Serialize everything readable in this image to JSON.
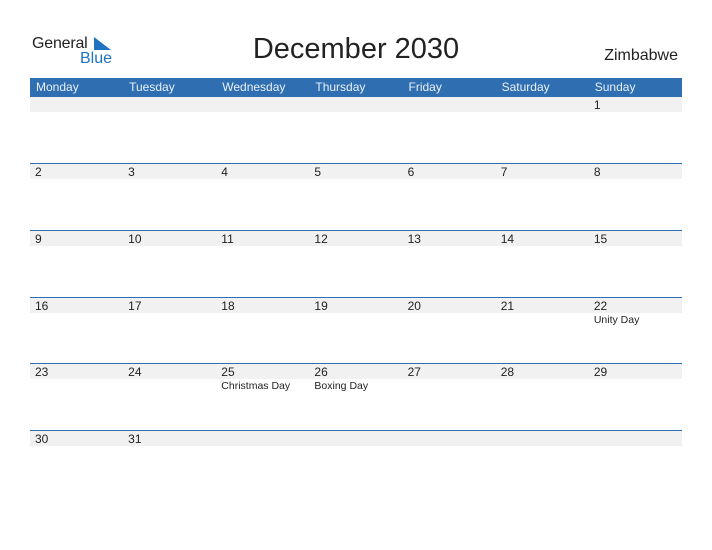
{
  "logo": {
    "line1": "General",
    "line2": "Blue",
    "accent_color": "#1f73c1"
  },
  "title": "December 2030",
  "country": "Zimbabwe",
  "header_color": "#2f6fb1",
  "weekdays": [
    "Monday",
    "Tuesday",
    "Wednesday",
    "Thursday",
    "Friday",
    "Saturday",
    "Sunday"
  ],
  "weeks": [
    [
      {
        "day": ""
      },
      {
        "day": ""
      },
      {
        "day": ""
      },
      {
        "day": ""
      },
      {
        "day": ""
      },
      {
        "day": ""
      },
      {
        "day": "1"
      }
    ],
    [
      {
        "day": "2"
      },
      {
        "day": "3"
      },
      {
        "day": "4"
      },
      {
        "day": "5"
      },
      {
        "day": "6"
      },
      {
        "day": "7"
      },
      {
        "day": "8"
      }
    ],
    [
      {
        "day": "9"
      },
      {
        "day": "10"
      },
      {
        "day": "11"
      },
      {
        "day": "12"
      },
      {
        "day": "13"
      },
      {
        "day": "14"
      },
      {
        "day": "15"
      }
    ],
    [
      {
        "day": "16"
      },
      {
        "day": "17"
      },
      {
        "day": "18"
      },
      {
        "day": "19"
      },
      {
        "day": "20"
      },
      {
        "day": "21"
      },
      {
        "day": "22",
        "holiday": "Unity Day"
      }
    ],
    [
      {
        "day": "23"
      },
      {
        "day": "24"
      },
      {
        "day": "25",
        "holiday": "Christmas Day"
      },
      {
        "day": "26",
        "holiday": "Boxing Day"
      },
      {
        "day": "27"
      },
      {
        "day": "28"
      },
      {
        "day": "29"
      }
    ],
    [
      {
        "day": "30"
      },
      {
        "day": "31"
      },
      {
        "day": ""
      },
      {
        "day": ""
      },
      {
        "day": ""
      },
      {
        "day": ""
      },
      {
        "day": ""
      }
    ]
  ]
}
